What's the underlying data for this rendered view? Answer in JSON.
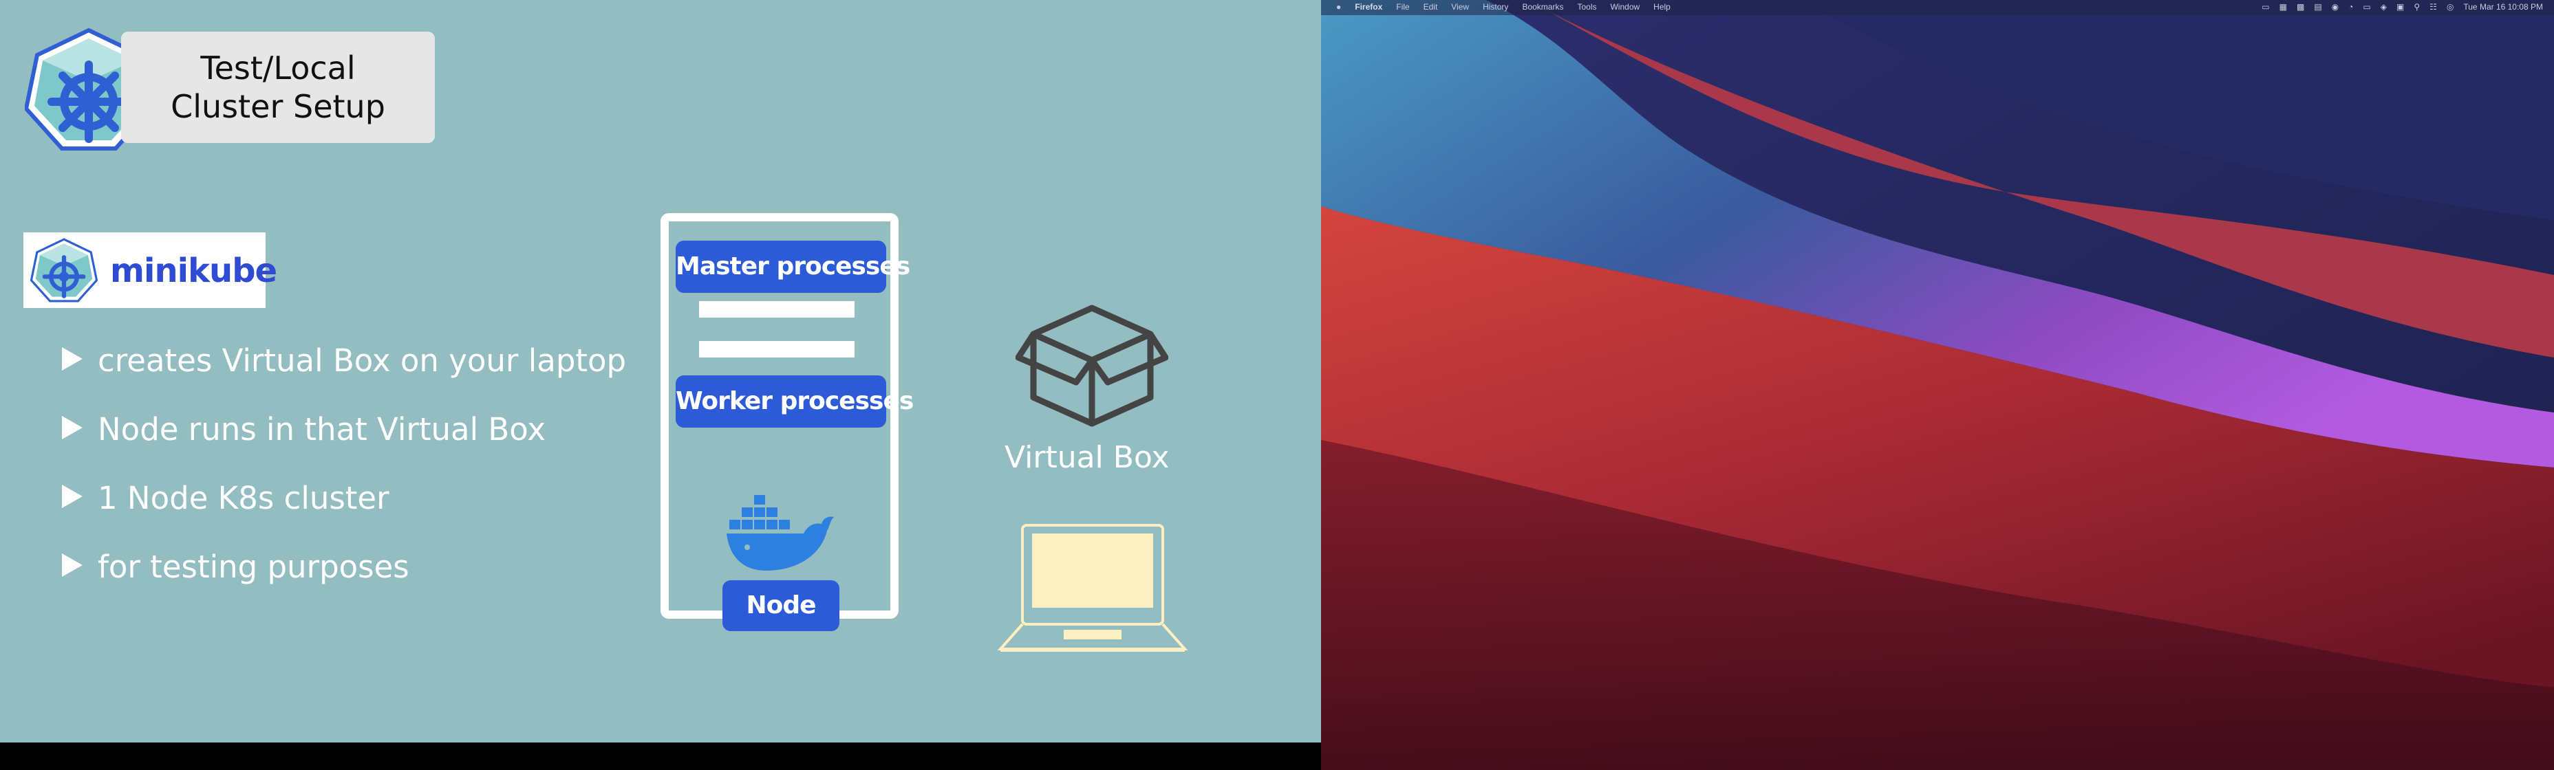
{
  "slide": {
    "title_lines": [
      "Test/Local",
      "Cluster Setup"
    ],
    "logo_word": "minikube",
    "bullets": [
      "creates Virtual Box on your laptop",
      "Node runs in that Virtual Box",
      "1 Node K8s cluster",
      "for testing purposes"
    ],
    "diagram": {
      "master_label": "Master processes",
      "worker_label": "Worker processes",
      "node_label": "Node",
      "virtualbox_label": "Virtual Box"
    },
    "colors": {
      "background": "#93bdc1",
      "accent_blue": "#2d5bd7",
      "laptop_fill": "#fcefc0"
    }
  },
  "desktop": {
    "menubar": {
      "apple_icon": "apple-icon",
      "app_name": "Firefox",
      "menus": [
        "File",
        "Edit",
        "View",
        "History",
        "Bookmarks",
        "Tools",
        "Window",
        "Help"
      ],
      "status_icons": [
        "display-icon",
        "grid-icon",
        "keyboard-icon",
        "layout-icon",
        "record-icon",
        "timer-icon",
        "battery-icon",
        "wifi-icon",
        "input-source-icon",
        "search-icon",
        "control-center-icon",
        "siri-icon"
      ],
      "datetime": "Tue Mar 16  10:08 PM"
    }
  }
}
